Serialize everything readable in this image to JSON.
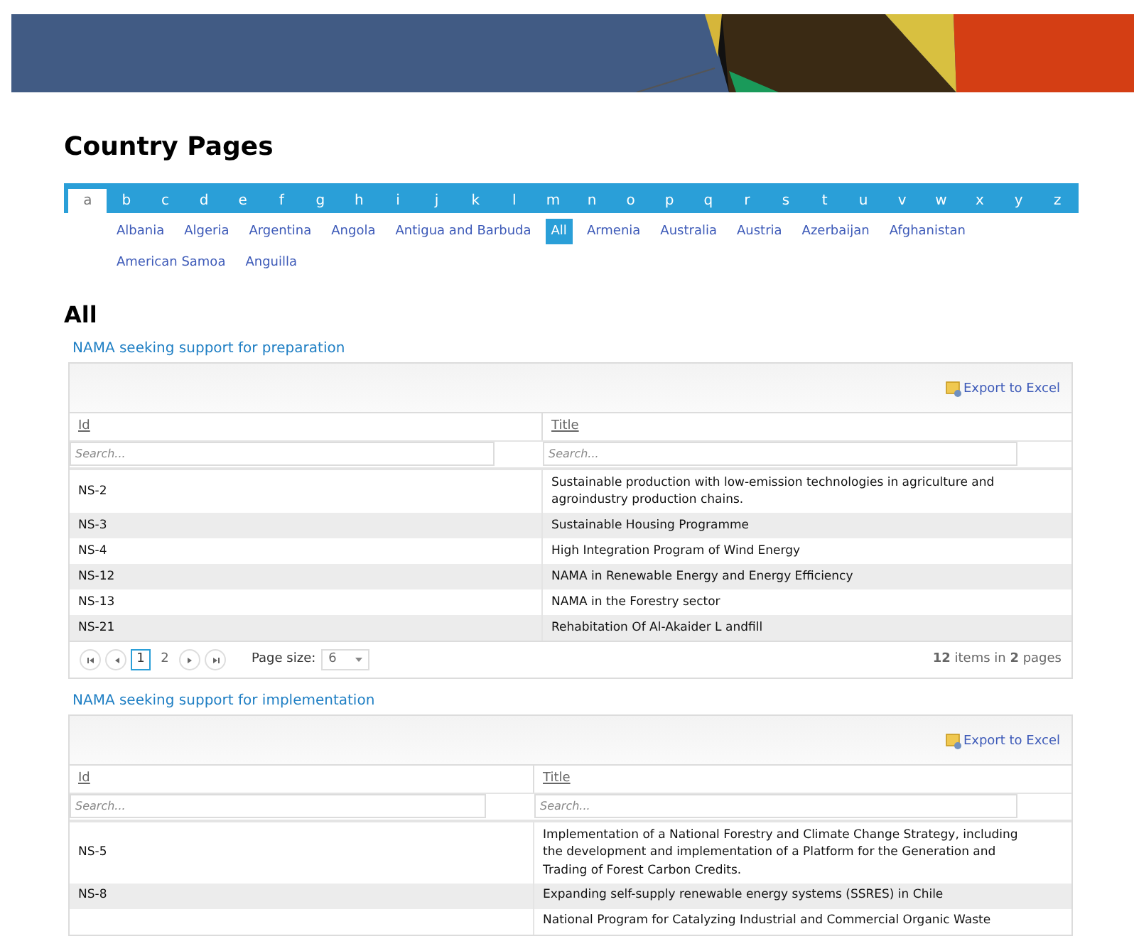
{
  "title": "Country Pages",
  "letters": [
    {
      "label": "a",
      "selected": true
    },
    {
      "label": "b",
      "selected": false
    },
    {
      "label": "c",
      "selected": false
    },
    {
      "label": "d",
      "selected": false
    },
    {
      "label": "e",
      "selected": false
    },
    {
      "label": "f",
      "selected": false
    },
    {
      "label": "g",
      "selected": false
    },
    {
      "label": "h",
      "selected": false
    },
    {
      "label": "i",
      "selected": false
    },
    {
      "label": "j",
      "selected": false
    },
    {
      "label": "k",
      "selected": false
    },
    {
      "label": "l",
      "selected": false
    },
    {
      "label": "m",
      "selected": false
    },
    {
      "label": "n",
      "selected": false
    },
    {
      "label": "o",
      "selected": false
    },
    {
      "label": "p",
      "selected": false
    },
    {
      "label": "q",
      "selected": false
    },
    {
      "label": "r",
      "selected": false
    },
    {
      "label": "s",
      "selected": false
    },
    {
      "label": "t",
      "selected": false
    },
    {
      "label": "u",
      "selected": false
    },
    {
      "label": "v",
      "selected": false
    },
    {
      "label": "w",
      "selected": false
    },
    {
      "label": "x",
      "selected": false
    },
    {
      "label": "y",
      "selected": false
    },
    {
      "label": "z",
      "selected": false
    }
  ],
  "countries": [
    {
      "label": "Albania",
      "selected": false
    },
    {
      "label": "Algeria",
      "selected": false
    },
    {
      "label": "Argentina",
      "selected": false
    },
    {
      "label": "Angola",
      "selected": false
    },
    {
      "label": "Antigua and Barbuda",
      "selected": false
    },
    {
      "label": "All",
      "selected": true
    },
    {
      "label": "Armenia",
      "selected": false
    },
    {
      "label": "Australia",
      "selected": false
    },
    {
      "label": "Austria",
      "selected": false
    },
    {
      "label": "Azerbaijan",
      "selected": false
    },
    {
      "label": "Afghanistan",
      "selected": false
    },
    {
      "label": "American Samoa",
      "selected": false
    },
    {
      "label": "Anguilla",
      "selected": false
    }
  ],
  "section_heading": "All",
  "grids": [
    {
      "title": "NAMA seeking support for preparation",
      "export": "Export to Excel",
      "columns": [
        "Id",
        "Title"
      ],
      "search_placeholders": [
        "Search...",
        "Search..."
      ],
      "rows": [
        {
          "id": "NS-2",
          "title": "Sustainable production with low-emission technologies in agriculture and agroindustry production chains."
        },
        {
          "id": "NS-3",
          "title": "Sustainable Housing Programme"
        },
        {
          "id": "NS-4",
          "title": "High Integration Program of Wind Energy"
        },
        {
          "id": "NS-12",
          "title": "NAMA in Renewable Energy and Energy Efficiency"
        },
        {
          "id": "NS-13",
          "title": "NAMA in the Forestry sector"
        },
        {
          "id": "NS-21",
          "title": "Rehabitation Of Al-Akaider L andfill"
        }
      ],
      "pager": {
        "pages": [
          {
            "label": "1",
            "selected": true
          },
          {
            "label": "2",
            "selected": false
          }
        ],
        "page_size_label": "Page size:",
        "page_size": "6",
        "summary": "**12** items in **2** pages"
      }
    },
    {
      "title": "NAMA seeking support for implementation",
      "export": "Export to Excel",
      "columns": [
        "Id",
        "Title"
      ],
      "search_placeholders": [
        "Search...",
        "Search..."
      ],
      "rows": [
        {
          "id": "NS-5",
          "title": "Implementation of a National Forestry and Climate Change Strategy, including the development and implementation of a Platform for the Generation and Trading of Forest Carbon Credits."
        },
        {
          "id": "NS-8",
          "title": "Expanding self-supply renewable energy systems (SSRES) in Chile"
        },
        {
          "title": "National Program for Catalyzing Industrial and Commercial Organic Waste"
        }
      ]
    }
  ]
}
